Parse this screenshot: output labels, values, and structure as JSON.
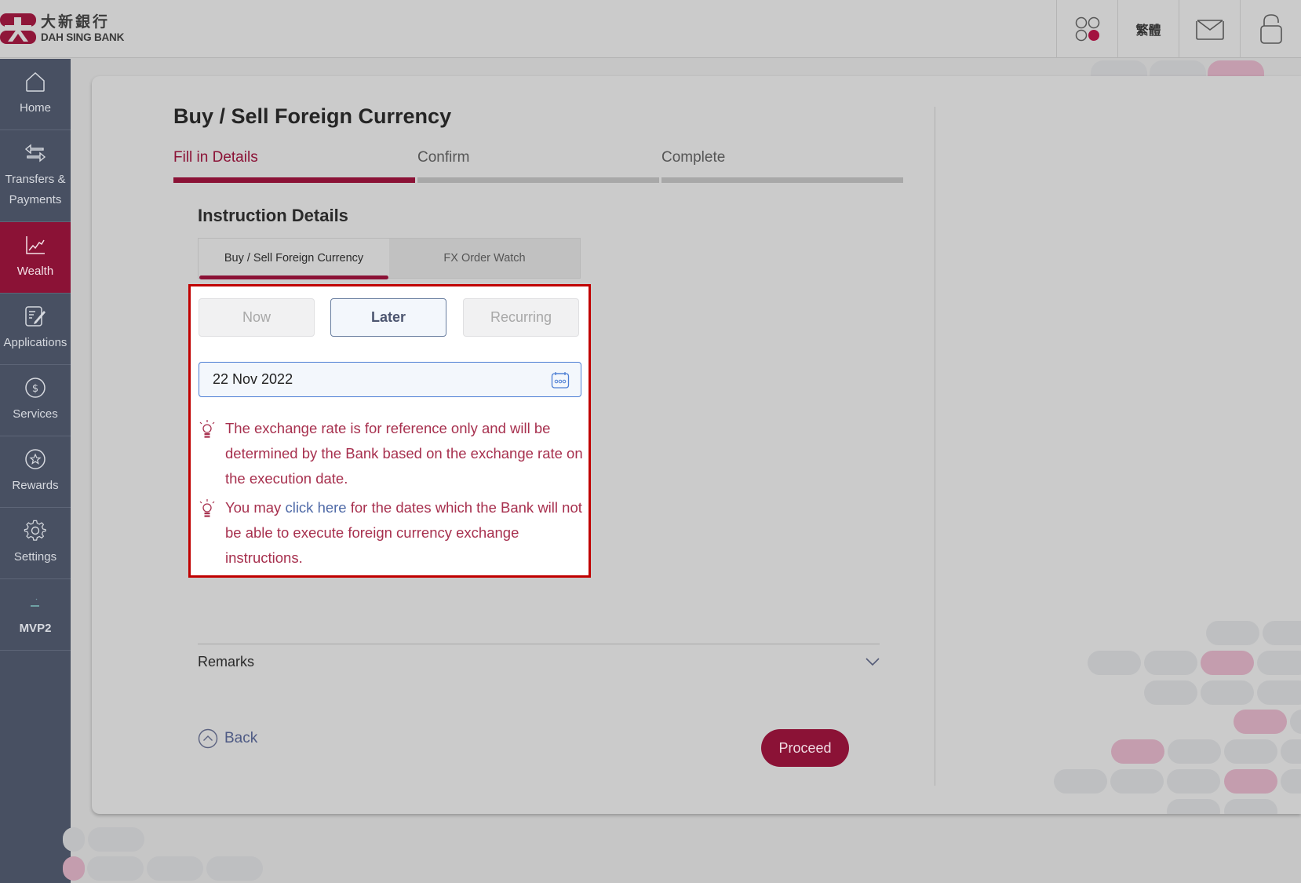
{
  "brand": {
    "name_cn": "大新銀行",
    "name_en": "DAH SING BANK",
    "color": "#8b1236"
  },
  "header": {
    "buttons": [
      {
        "name": "apps",
        "icon": "apps-grid-icon"
      },
      {
        "name": "language",
        "label": "繁體"
      },
      {
        "name": "inbox",
        "icon": "mail-icon"
      },
      {
        "name": "logout",
        "icon": "unlock-icon"
      }
    ]
  },
  "sidebar": {
    "items": [
      {
        "label": "Home",
        "icon": "home-icon",
        "active": false
      },
      {
        "label": "Transfers &\nPayments",
        "icon": "transfer-icon",
        "active": false
      },
      {
        "label": "Wealth",
        "icon": "chart-line-icon",
        "active": true
      },
      {
        "label": "Applications",
        "icon": "edit-document-icon",
        "active": false
      },
      {
        "label": "Services",
        "icon": "dollar-circle-icon",
        "active": false
      },
      {
        "label": "Rewards",
        "icon": "star-circle-icon",
        "active": false
      },
      {
        "label": "Settings",
        "icon": "gear-icon",
        "active": false
      },
      {
        "label": "MVP2",
        "icon": "mvp-icon",
        "active": false
      }
    ]
  },
  "page": {
    "title": "Buy / Sell Foreign Currency",
    "steps": [
      {
        "label": "Fill in Details",
        "active": true
      },
      {
        "label": "Confirm",
        "active": false
      },
      {
        "label": "Complete",
        "active": false
      }
    ],
    "section_title": "Instruction Details",
    "subtabs": [
      {
        "label": "Buy / Sell Foreign Currency",
        "active": true
      },
      {
        "label": "FX Order Watch",
        "active": false
      }
    ],
    "modes": [
      {
        "label": "Now",
        "selected": false
      },
      {
        "label": "Later",
        "selected": true
      },
      {
        "label": "Recurring",
        "selected": false
      }
    ],
    "date_value": "22 Nov 2022",
    "notes": {
      "first": "The exchange rate is for reference only and will be determined by the Bank based on the exchange rate on the execution date.",
      "second_before": "You may ",
      "second_link": "click here",
      "second_after": " for the dates which the Bank will not be able to execute foreign currency exchange instructions."
    },
    "remarks_label": "Remarks",
    "back_label": "Back",
    "proceed_label": "Proceed"
  }
}
